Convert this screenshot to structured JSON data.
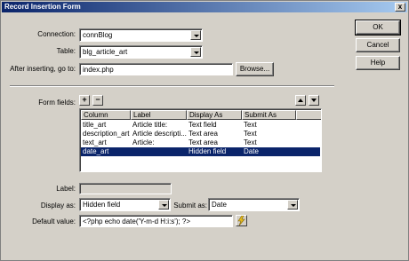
{
  "window": {
    "title": "Record Insertion Form",
    "close_glyph": "x"
  },
  "form": {
    "connection_label": "Connection:",
    "connection_value": "connBlog",
    "table_label": "Table:",
    "table_value": "blg_article_art",
    "after_label": "After inserting, go to:",
    "after_value": "index.php",
    "browse_label": "Browse...",
    "form_fields_label": "Form fields:",
    "add_glyph": "+",
    "remove_glyph": "−"
  },
  "grid": {
    "columns": [
      "Column",
      "Label",
      "Display As",
      "Submit As"
    ],
    "rows": [
      {
        "column": "title_art",
        "label": "Article title:",
        "display": "Text field",
        "submit": "Text"
      },
      {
        "column": "description_art",
        "label": "Article descripti...",
        "display": "Text area",
        "submit": "Text"
      },
      {
        "column": "text_art",
        "label": "Article:",
        "display": "Text area",
        "submit": "Text"
      },
      {
        "column": "date_art",
        "label": "",
        "display": "Hidden field",
        "submit": "Date"
      }
    ],
    "selected_index": 3
  },
  "details": {
    "label_label": "Label:",
    "label_value": "",
    "display_label": "Display as:",
    "display_value": "Hidden field",
    "submit_label": "Submit as:",
    "submit_value": "Date",
    "default_label": "Default value:",
    "default_value": "<?php echo date('Y-m-d H:i:s'); ?>"
  },
  "buttons": {
    "ok": "OK",
    "cancel": "Cancel",
    "help": "Help"
  },
  "icons": {
    "move_up": "move-up-icon",
    "move_down": "move-down-icon",
    "dynamic_data": "lightning-icon"
  },
  "colors": {
    "selection": "#0a246a",
    "titlebar": "#0a246a",
    "face": "#d4d0c8"
  }
}
